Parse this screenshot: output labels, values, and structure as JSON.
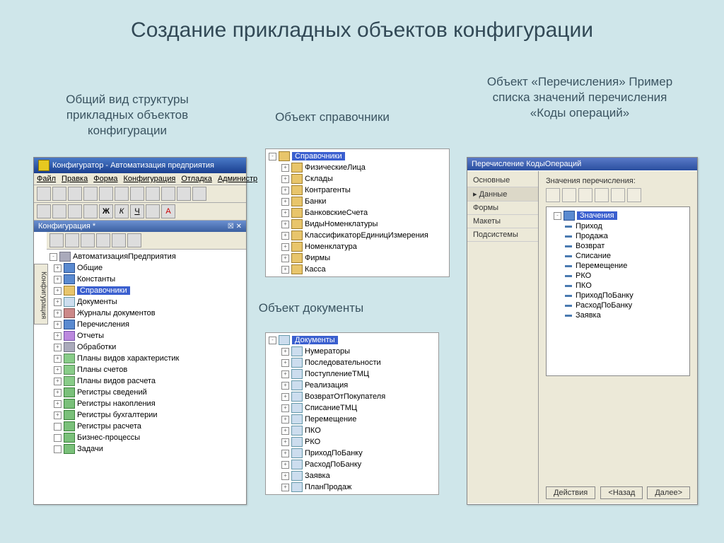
{
  "slide_title": "Создание прикладных объектов конфигурации",
  "captions": {
    "c1": "Общий вид структуры прикладных объектов конфигурации",
    "c2": "Объект справочники",
    "c3": "Объект документы",
    "c4": "Объект «Перечисления» Пример списка значений перечисления «Коды операций»"
  },
  "panel1": {
    "title": "Конфигуратор - Автоматизация предприятия",
    "menus": [
      "Файл",
      "Правка",
      "Форма",
      "Конфигурация",
      "Отладка",
      "Администр"
    ],
    "inner_title": "Конфигурация *",
    "sidebar_tab": "Конфигурация",
    "root": "АвтоматизацияПредприятия",
    "items": [
      "Общие",
      "Константы",
      "Справочники",
      "Документы",
      "Журналы документов",
      "Перечисления",
      "Отчеты",
      "Обработки",
      "Планы видов характеристик",
      "Планы счетов",
      "Планы видов расчета",
      "Регистры сведений",
      "Регистры накопления",
      "Регистры бухгалтерии",
      "Регистры расчета",
      "Бизнес-процессы",
      "Задачи"
    ],
    "selected": "Справочники"
  },
  "panel2": {
    "root": "Справочники",
    "items": [
      "ФизическиеЛица",
      "Склады",
      "Контрагенты",
      "Банки",
      "БанковскиеСчета",
      "ВидыНоменклатуры",
      "КлассификаторЕдиницИзмерения",
      "Номенклатура",
      "Фирмы",
      "Касса"
    ]
  },
  "panel3": {
    "root": "Документы",
    "items": [
      "Нумераторы",
      "Последовательности",
      "ПоступлениеТМЦ",
      "Реализация",
      "ВозвратОтПокупателя",
      "СписаниеТМЦ",
      "Перемещение",
      "ПКО",
      "РКО",
      "ПриходПоБанку",
      "РасходПоБанку",
      "Заявка",
      "ПланПродаж"
    ]
  },
  "panel4": {
    "title": "Перечисление КодыОпераций",
    "tabs": [
      "Основные",
      "Данные",
      "Формы",
      "Макеты",
      "Подсистемы"
    ],
    "active_tab": "Данные",
    "label": "Значения перечисления:",
    "root": "Значения",
    "items": [
      "Приход",
      "Продажа",
      "Возврат",
      "Списание",
      "Перемещение",
      "РКО",
      "ПКО",
      "ПриходПоБанку",
      "РасходПоБанку",
      "Заявка"
    ],
    "btn_actions": "Действия",
    "btn_back": "<Назад",
    "btn_next": "Далее>"
  }
}
